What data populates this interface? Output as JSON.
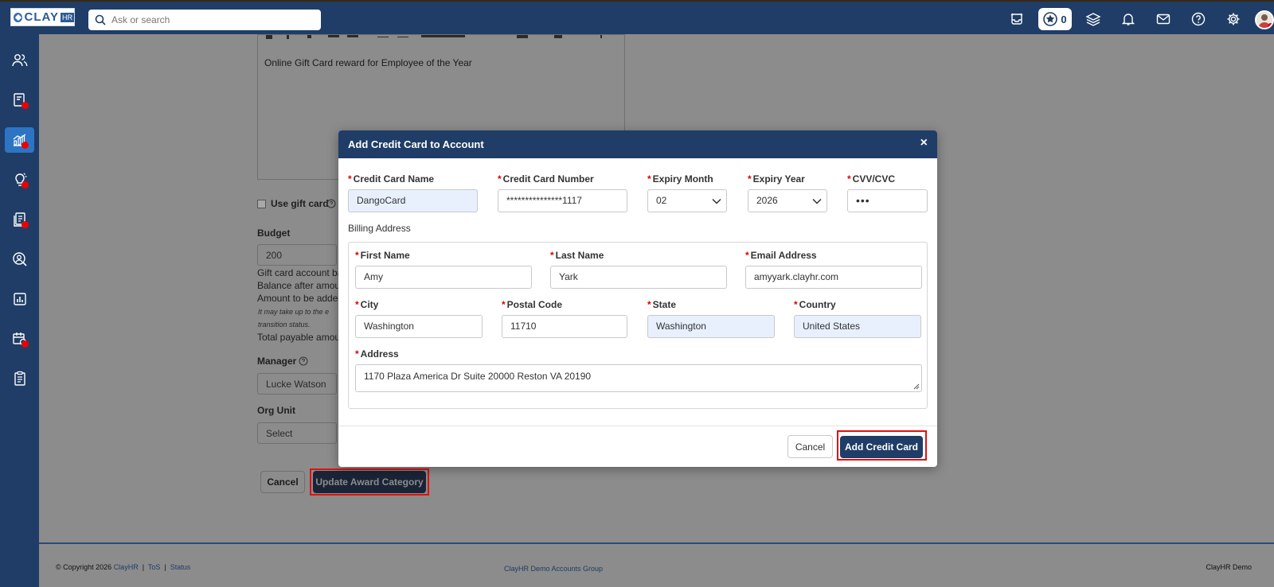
{
  "app": {
    "logo_text": "CLAY",
    "logo_sub": "HR",
    "search_placeholder": "Ask or search",
    "rewards_count": "0"
  },
  "page": {
    "description_text": "Online Gift Card reward for Employee of the Year",
    "use_gift_card_label": "Use gift card",
    "budget_label": "Budget",
    "budget_value": "200",
    "line_balance": "Gift card account ba",
    "line_after": "Balance after amou",
    "line_added": "Amount to be added",
    "note_1": "It may take up to the e",
    "note_2": "transition status.",
    "line_total": "Total payable amou",
    "manager_label": "Manager",
    "manager_value": "Lucke Watson",
    "org_unit_label": "Org Unit",
    "org_unit_value": "Select",
    "cancel_label": "Cancel",
    "update_label": "Update Award Category"
  },
  "footer": {
    "copyright": "© Copyright 2026",
    "company_link": "ClayHR",
    "tos": "ToS",
    "status": "Status",
    "sep": "|",
    "center": "ClayHR Demo Accounts Group",
    "right": "ClayHR Demo"
  },
  "modal": {
    "title": "Add Credit Card to Account",
    "close": "×",
    "required_mark": "*",
    "card_name_label": "Credit Card Name",
    "card_name_value": "DangoCard",
    "card_number_label": "Credit Card Number",
    "card_number_value": "***************1117",
    "expiry_month_label": "Expiry Month",
    "expiry_month_value": "02",
    "expiry_year_label": "Expiry Year",
    "expiry_year_value": "2026",
    "cvv_label": "CVV/CVC",
    "cvv_value": "•••",
    "billing_title": "Billing Address",
    "first_name_label": "First Name",
    "first_name_value": "Amy",
    "last_name_label": "Last Name",
    "last_name_value": "Yark",
    "email_label": "Email Address",
    "email_value": "amyyark.clayhr.com",
    "city_label": "City",
    "city_value": "Washington",
    "postal_label": "Postal Code",
    "postal_value": "11710",
    "state_label": "State",
    "state_value": "Washington",
    "country_label": "Country",
    "country_value": "United States",
    "address_label": "Address",
    "address_value": "1170 Plaza  America  Dr Suite 20000 Reston VA 20190",
    "cancel_label": "Cancel",
    "add_label": "Add Credit Card"
  }
}
